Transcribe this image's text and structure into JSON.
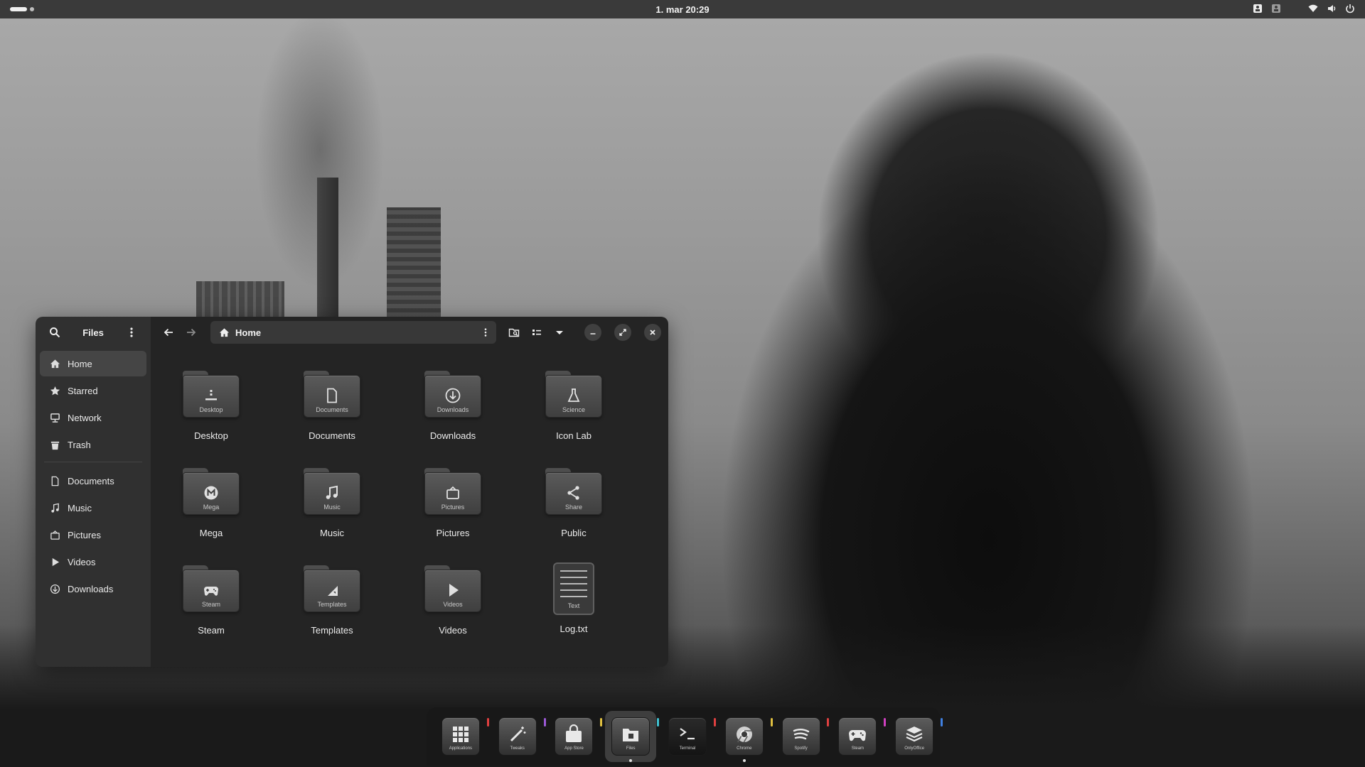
{
  "topbar": {
    "clock": "1. mar  20:29",
    "tray_icons": [
      "accessibility-icon",
      "user-icon",
      "wifi-icon",
      "volume-icon",
      "power-icon"
    ]
  },
  "window": {
    "sidebar": {
      "title": "Files",
      "places": [
        {
          "label": "Home",
          "icon": "home-icon"
        },
        {
          "label": "Starred",
          "icon": "star-icon"
        },
        {
          "label": "Network",
          "icon": "network-icon"
        },
        {
          "label": "Trash",
          "icon": "trash-icon"
        }
      ],
      "bookmarks": [
        {
          "label": "Documents",
          "icon": "document-icon"
        },
        {
          "label": "Music",
          "icon": "music-icon"
        },
        {
          "label": "Pictures",
          "icon": "pictures-icon"
        },
        {
          "label": "Videos",
          "icon": "video-icon"
        },
        {
          "label": "Downloads",
          "icon": "download-icon"
        }
      ]
    },
    "path": {
      "label": "Home"
    },
    "items": [
      {
        "label": "Desktop",
        "sub": "Desktop"
      },
      {
        "label": "Documents",
        "sub": "Documents"
      },
      {
        "label": "Downloads",
        "sub": "Downloads"
      },
      {
        "label": "Icon Lab",
        "sub": "Science"
      },
      {
        "label": "Mega",
        "sub": "Mega"
      },
      {
        "label": "Music",
        "sub": "Music"
      },
      {
        "label": "Pictures",
        "sub": "Pictures"
      },
      {
        "label": "Public",
        "sub": "Share"
      },
      {
        "label": "Steam",
        "sub": "Steam"
      },
      {
        "label": "Templates",
        "sub": "Templates"
      },
      {
        "label": "Videos",
        "sub": "Videos"
      },
      {
        "label": "Log.txt",
        "sub": "Text"
      }
    ]
  },
  "dock": {
    "apps": [
      {
        "caption": "Applications",
        "accent": "#e04040"
      },
      {
        "caption": "Tweaks",
        "accent": "#9b59d6"
      },
      {
        "caption": "App Store",
        "accent": "#e0c040"
      },
      {
        "caption": "Files",
        "accent": "#40c0d0"
      },
      {
        "caption": "Terminal",
        "accent": "#e04040"
      },
      {
        "caption": "Chrome",
        "accent": "#e0c040"
      },
      {
        "caption": "Spotify",
        "accent": "#e04040"
      },
      {
        "caption": "Steam",
        "accent": "#d040c0"
      },
      {
        "caption": "OnlyOffice",
        "accent": "#4080e0"
      }
    ]
  }
}
